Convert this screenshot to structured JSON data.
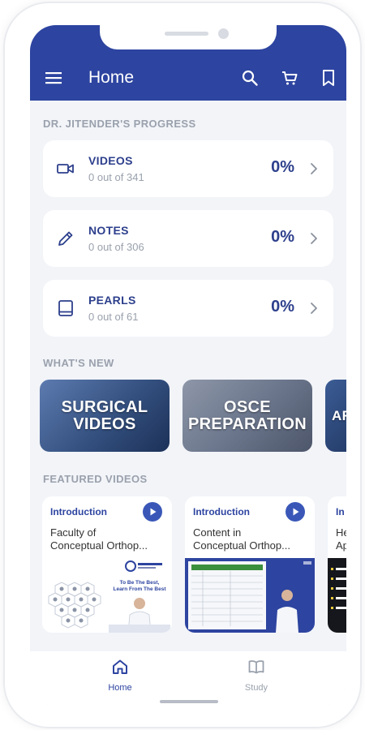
{
  "header": {
    "title": "Home",
    "icons": [
      "menu-icon",
      "search-icon",
      "cart-icon",
      "bookmark-icon"
    ],
    "color": "#2d44a0"
  },
  "progress": {
    "section_title": "DR. JITENDER'S PROGRESS",
    "items": [
      {
        "name": "VIDEOS",
        "sub": "0 out of 341",
        "percent": "0%",
        "icon": "video-camera-icon"
      },
      {
        "name": "NOTES",
        "sub": "0 out of 306",
        "percent": "0%",
        "icon": "pencil-icon"
      },
      {
        "name": "PEARLS",
        "sub": "0 out of 61",
        "percent": "0%",
        "icon": "book-icon"
      }
    ]
  },
  "whats_new": {
    "section_title": "WHAT'S NEW",
    "tiles": [
      "SURGICAL VIDEOS",
      "OSCE PREPARATION",
      "AR"
    ]
  },
  "featured": {
    "section_title": "FEATURED VIDEOS",
    "videos": [
      {
        "tag": "Introduction",
        "title": "Faculty of Conceptual Orthop...",
        "thumb_tagline": "To Be The Best, Learn From The Best"
      },
      {
        "tag": "Introduction",
        "title": "Content in Conceptual Orthop..."
      },
      {
        "tag": "In",
        "title": "He Ap"
      }
    ]
  },
  "nav": {
    "items": [
      {
        "label": "Home",
        "icon": "home-icon",
        "active": true
      },
      {
        "label": "Study",
        "icon": "open-book-icon",
        "active": false
      }
    ]
  }
}
